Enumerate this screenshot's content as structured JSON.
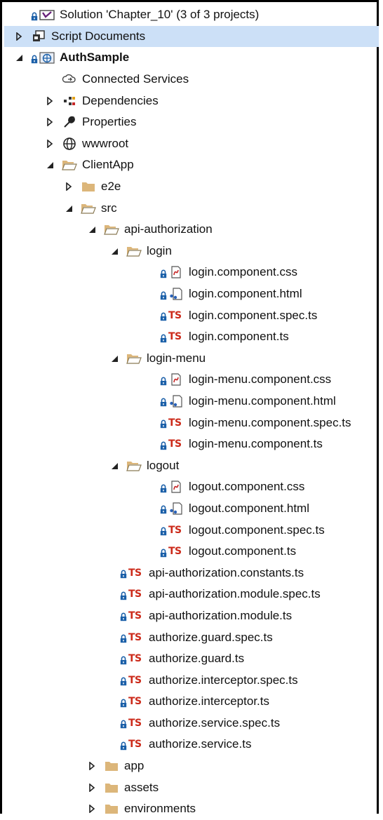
{
  "tree": [
    {
      "label": "Solution 'Chapter_10' (3 of 3 projects)",
      "depth": 0,
      "arrow": "none",
      "icon": "solution-icon",
      "lock": true
    },
    {
      "label": "Script Documents",
      "depth": 0,
      "arrow": "collapsed",
      "icon": "script-documents-icon",
      "lock": false,
      "selected": true
    },
    {
      "label": "AuthSample",
      "depth": 0,
      "arrow": "expanded",
      "icon": "web-project-icon",
      "lock": true,
      "bold": true
    },
    {
      "label": "Connected Services",
      "depth": 1,
      "arrow": "none",
      "icon": "connected-services-icon",
      "lock": false
    },
    {
      "label": "Dependencies",
      "depth": 1,
      "arrow": "collapsed",
      "icon": "dependencies-icon",
      "lock": false
    },
    {
      "label": "Properties",
      "depth": 1,
      "arrow": "collapsed",
      "icon": "wrench-icon",
      "lock": false
    },
    {
      "label": "wwwroot",
      "depth": 1,
      "arrow": "collapsed",
      "icon": "globe-icon",
      "lock": false
    },
    {
      "label": "ClientApp",
      "depth": 1,
      "arrow": "expanded",
      "icon": "folder-open-icon",
      "lock": false
    },
    {
      "label": "e2e",
      "depth": 2,
      "arrow": "collapsed",
      "icon": "folder-icon",
      "lock": false
    },
    {
      "label": "src",
      "depth": 2,
      "arrow": "expanded",
      "icon": "folder-open-icon",
      "lock": false
    },
    {
      "label": "api-authorization",
      "depth": 3,
      "arrow": "expanded",
      "icon": "folder-open-icon",
      "lock": false
    },
    {
      "label": "login",
      "depth": 4,
      "arrow": "expanded",
      "icon": "folder-open-icon",
      "lock": false
    },
    {
      "label": "login.component.css",
      "depth": 5,
      "arrow": "none",
      "icon": "css-file-icon",
      "lock": true
    },
    {
      "label": "login.component.html",
      "depth": 5,
      "arrow": "none",
      "icon": "html-file-icon",
      "lock": true
    },
    {
      "label": "login.component.spec.ts",
      "depth": 5,
      "arrow": "none",
      "icon": "ts-file-icon",
      "lock": true
    },
    {
      "label": "login.component.ts",
      "depth": 5,
      "arrow": "none",
      "icon": "ts-file-icon",
      "lock": true
    },
    {
      "label": "login-menu",
      "depth": 4,
      "arrow": "expanded",
      "icon": "folder-open-icon",
      "lock": false
    },
    {
      "label": "login-menu.component.css",
      "depth": 5,
      "arrow": "none",
      "icon": "css-file-icon",
      "lock": true
    },
    {
      "label": "login-menu.component.html",
      "depth": 5,
      "arrow": "none",
      "icon": "html-file-icon",
      "lock": true
    },
    {
      "label": "login-menu.component.spec.ts",
      "depth": 5,
      "arrow": "none",
      "icon": "ts-file-icon",
      "lock": true
    },
    {
      "label": "login-menu.component.ts",
      "depth": 5,
      "arrow": "none",
      "icon": "ts-file-icon",
      "lock": true
    },
    {
      "label": "logout",
      "depth": 4,
      "arrow": "expanded",
      "icon": "folder-open-icon",
      "lock": false
    },
    {
      "label": "logout.component.css",
      "depth": 5,
      "arrow": "none",
      "icon": "css-file-icon",
      "lock": true
    },
    {
      "label": "logout.component.html",
      "depth": 5,
      "arrow": "none",
      "icon": "html-file-icon",
      "lock": true
    },
    {
      "label": "logout.component.spec.ts",
      "depth": 5,
      "arrow": "none",
      "icon": "ts-file-icon",
      "lock": true
    },
    {
      "label": "logout.component.ts",
      "depth": 5,
      "arrow": "none",
      "icon": "ts-file-icon",
      "lock": true
    },
    {
      "label": "api-authorization.constants.ts",
      "depth": 4,
      "arrow": "none",
      "icon": "ts-file-icon",
      "lock": true,
      "noarrowslot": true
    },
    {
      "label": "api-authorization.module.spec.ts",
      "depth": 4,
      "arrow": "none",
      "icon": "ts-file-icon",
      "lock": true,
      "noarrowslot": true
    },
    {
      "label": "api-authorization.module.ts",
      "depth": 4,
      "arrow": "none",
      "icon": "ts-file-icon",
      "lock": true,
      "noarrowslot": true
    },
    {
      "label": "authorize.guard.spec.ts",
      "depth": 4,
      "arrow": "none",
      "icon": "ts-file-icon",
      "lock": true,
      "noarrowslot": true
    },
    {
      "label": "authorize.guard.ts",
      "depth": 4,
      "arrow": "none",
      "icon": "ts-file-icon",
      "lock": true,
      "noarrowslot": true
    },
    {
      "label": "authorize.interceptor.spec.ts",
      "depth": 4,
      "arrow": "none",
      "icon": "ts-file-icon",
      "lock": true,
      "noarrowslot": true
    },
    {
      "label": "authorize.interceptor.ts",
      "depth": 4,
      "arrow": "none",
      "icon": "ts-file-icon",
      "lock": true,
      "noarrowslot": true
    },
    {
      "label": "authorize.service.spec.ts",
      "depth": 4,
      "arrow": "none",
      "icon": "ts-file-icon",
      "lock": true,
      "noarrowslot": true
    },
    {
      "label": "authorize.service.ts",
      "depth": 4,
      "arrow": "none",
      "icon": "ts-file-icon",
      "lock": true,
      "noarrowslot": true
    },
    {
      "label": "app",
      "depth": 3,
      "arrow": "collapsed",
      "icon": "folder-icon",
      "lock": false
    },
    {
      "label": "assets",
      "depth": 3,
      "arrow": "collapsed",
      "icon": "folder-icon",
      "lock": false
    },
    {
      "label": "environments",
      "depth": 3,
      "arrow": "collapsed",
      "icon": "folder-icon",
      "lock": false
    }
  ],
  "colors": {
    "selected_bg": "#cce0f7",
    "folder": "#dcb67a",
    "ts_red": "#cc2a1a",
    "lock_blue": "#1a5fa8"
  }
}
